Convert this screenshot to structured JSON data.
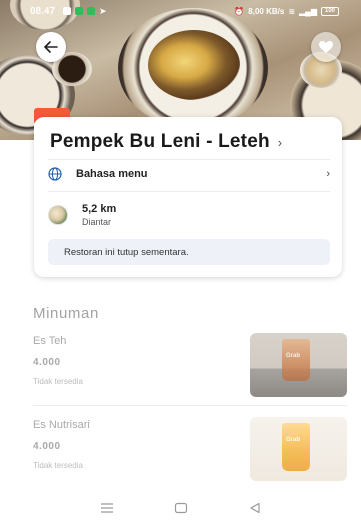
{
  "status_bar": {
    "time": "08.47",
    "net_speed": "8,00 KB/s",
    "battery": "100"
  },
  "restaurant": {
    "name": "Pempek Bu Leni - Leteh",
    "language_label": "Bahasa menu",
    "distance": "5,2 km",
    "delivery_mode": "Diantar",
    "closed_notice": "Restoran ini tutup sementara."
  },
  "menu": {
    "section_title": "Minuman",
    "items": [
      {
        "name": "Es Teh",
        "price": "4.000",
        "status": "Tidak tersedia",
        "image_label": "Grab"
      },
      {
        "name": "Es Nutrisari",
        "price": "4.000",
        "status": "Tidak tersedia",
        "image_label": "Grab"
      }
    ]
  },
  "colors": {
    "promo_tag": "#f25a3a",
    "notice_bg": "#eef1f7"
  },
  "icons": {
    "back": "arrow-left-icon",
    "favorite": "heart-icon",
    "language": "globe-icon",
    "chevron": "chevron-right-icon",
    "nav_menu": "menu-lines-icon",
    "nav_home": "square-icon",
    "nav_back": "triangle-back-icon"
  }
}
